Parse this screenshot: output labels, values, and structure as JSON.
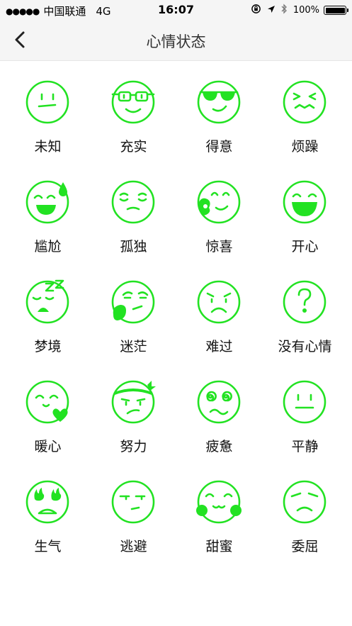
{
  "status_bar": {
    "signal": "●●●●●",
    "carrier": "中国联通",
    "network": "4G",
    "time": "16:07",
    "battery": "100%",
    "battery_level": 1.0,
    "icons": [
      "rotation-lock-icon",
      "location-arrow-icon",
      "bluetooth-icon",
      "battery-icon"
    ]
  },
  "nav": {
    "title": "心情状态",
    "back_icon": "chevron-left-icon"
  },
  "theme": {
    "accent": "#22e222",
    "bar_bg": "#f5f5f5"
  },
  "moods": [
    {
      "label": "未知",
      "icon": "unknown-face-icon"
    },
    {
      "label": "充实",
      "icon": "glasses-face-icon"
    },
    {
      "label": "得意",
      "icon": "sunglasses-face-icon"
    },
    {
      "label": "烦躁",
      "icon": "annoyed-face-icon"
    },
    {
      "label": "尴尬",
      "icon": "sweat-face-icon"
    },
    {
      "label": "孤独",
      "icon": "lonely-face-icon"
    },
    {
      "label": "惊喜",
      "icon": "surprised-face-icon"
    },
    {
      "label": "开心",
      "icon": "happy-face-icon"
    },
    {
      "label": "梦境",
      "icon": "sleeping-face-icon"
    },
    {
      "label": "迷茫",
      "icon": "confused-face-icon"
    },
    {
      "label": "难过",
      "icon": "sad-face-icon"
    },
    {
      "label": "没有心情",
      "icon": "question-face-icon"
    },
    {
      "label": "暖心",
      "icon": "heart-face-icon"
    },
    {
      "label": "努力",
      "icon": "headband-face-icon"
    },
    {
      "label": "疲惫",
      "icon": "dizzy-face-icon"
    },
    {
      "label": "平静",
      "icon": "calm-face-icon"
    },
    {
      "label": "生气",
      "icon": "angry-face-icon"
    },
    {
      "label": "逃避",
      "icon": "avoiding-face-icon"
    },
    {
      "label": "甜蜜",
      "icon": "blushing-face-icon"
    },
    {
      "label": "委屈",
      "icon": "aggrieved-face-icon"
    }
  ]
}
